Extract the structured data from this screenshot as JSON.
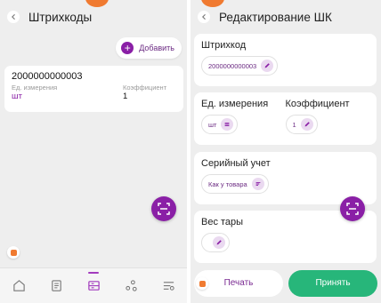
{
  "left": {
    "title": "Штрихкоды",
    "add_label": "Добавить",
    "barcode": {
      "code": "2000000000003",
      "unit_label": "Ед. измерения",
      "unit_value": "шт",
      "coef_label": "Коэффициент",
      "coef_value": "1"
    },
    "nav": [
      {
        "icon": "home-icon"
      },
      {
        "icon": "documents-icon"
      },
      {
        "icon": "barcode-list-icon",
        "active": true
      },
      {
        "icon": "network-icon"
      },
      {
        "icon": "filter-settings-icon"
      }
    ]
  },
  "right": {
    "title": "Редактирование ШК",
    "barcode_label": "Штрихкод",
    "barcode_value": "2000000000003",
    "unit_label": "Ед. измерения",
    "unit_value": "шт",
    "coef_label": "Коэффициент",
    "coef_value": "1",
    "serial_label": "Серийный учет",
    "serial_value": "Как у товара",
    "tare_label": "Вес тары",
    "tare_value": "",
    "print_label": "Печать",
    "accept_label": "Принять"
  },
  "colors": {
    "accent": "#8a1fa6",
    "accept": "#27b67a",
    "badge": "#f07a30",
    "background": "#eeeeee"
  }
}
